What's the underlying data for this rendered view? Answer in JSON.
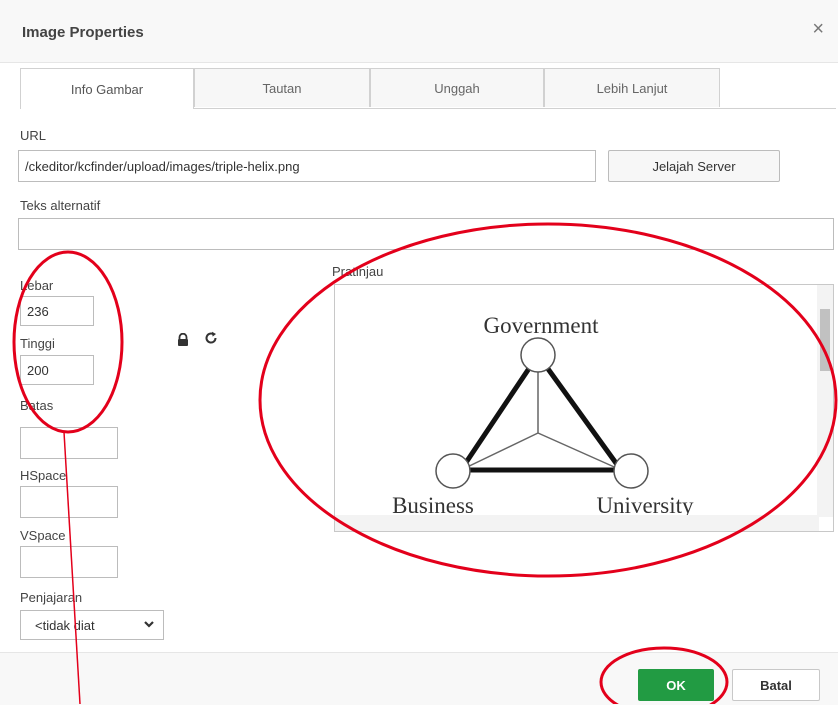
{
  "dialog": {
    "title": "Image Properties",
    "close_glyph": "×"
  },
  "tabs": [
    {
      "label": "Info Gambar",
      "active": true
    },
    {
      "label": "Tautan",
      "active": false
    },
    {
      "label": "Unggah",
      "active": false
    },
    {
      "label": "Lebih Lanjut",
      "active": false
    }
  ],
  "url": {
    "label": "URL",
    "value": "/ckeditor/kcfinder/upload/images/triple-helix.png",
    "browse_label": "Jelajah Server"
  },
  "alt": {
    "label": "Teks alternatif",
    "value": ""
  },
  "width": {
    "label": "Lebar",
    "value": "236"
  },
  "height": {
    "label": "Tinggi",
    "value": "200"
  },
  "border": {
    "label": "Batas",
    "value": ""
  },
  "hspace": {
    "label": "HSpace",
    "value": ""
  },
  "vspace": {
    "label": "VSpace",
    "value": ""
  },
  "align": {
    "label": "Penjajaran",
    "selected": "<tidak diat"
  },
  "icons": {
    "lock": "lock-icon",
    "reset": "reset-size-icon"
  },
  "preview": {
    "label": "Pratinjau",
    "image_labels": {
      "top": "Government",
      "left": "Business",
      "right": "University"
    }
  },
  "footer": {
    "ok_label": "OK",
    "cancel_label": "Batal"
  },
  "colors": {
    "ok_button": "#229b43",
    "annotation": "#e3001b"
  }
}
